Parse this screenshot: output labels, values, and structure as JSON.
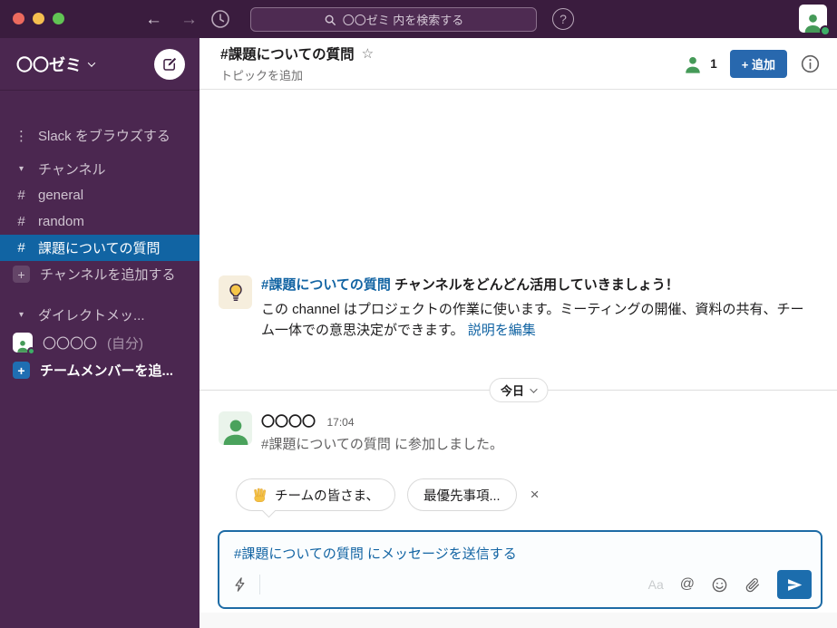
{
  "topbar": {
    "search_placeholder": "〇〇ゼミ 内を検索する"
  },
  "glyphs": {
    "hash": "#",
    "plus": "+",
    "star": "☆",
    "close": "×",
    "dots": "⋮",
    "chevron_down": "▾",
    "at": "@",
    "question": "?"
  },
  "sidebar": {
    "workspace_name": "〇〇ゼミ",
    "browse_label": "Slack をブラウズする",
    "channels_header": "チャンネル",
    "channels": [
      {
        "name": "general"
      },
      {
        "name": "random"
      },
      {
        "name": "課題についての質問"
      }
    ],
    "add_channel_label": "チャンネルを追加する",
    "dm_header": "ダイレクトメッ...",
    "dm_self_name": "〇〇〇〇",
    "dm_self_suffix": "(自分)",
    "add_teammates_label": "チームメンバーを追..."
  },
  "channel_header": {
    "title": "#課題についての質問",
    "topic_label": "トピックを追加",
    "member_count": "1",
    "add_button_label": "+ 追加"
  },
  "intro": {
    "channel_link": "#課題についての質問",
    "headline": "チャンネルをどんどん活用していきましょう！",
    "body": "この channel はプロジェクトの作業に使います。ミーティングの開催、資料の共有、チーム一体での意思決定ができます。",
    "edit_link": "説明を編集"
  },
  "date_divider": {
    "label": "今日"
  },
  "message": {
    "author": "〇〇〇〇",
    "time": "17:04",
    "text": "#課題についての質問 に参加しました。"
  },
  "suggestions": {
    "chips": [
      {
        "emoji": "👋",
        "label": "チームの皆さま、"
      },
      {
        "label": "最優先事項..."
      }
    ],
    "close": "×"
  },
  "composer": {
    "placeholder": "#課題についての質問 にメッセージを送信する",
    "aa_label": "Aa",
    "at_label": "@"
  },
  "colors": {
    "topbar_purple": "#3a1c3e",
    "sidebar_purple": "#4b2750",
    "selected_blue": "#1164a3",
    "link_blue": "#1264a3",
    "button_blue": "#2868ae",
    "avatar_green": "#459a58"
  }
}
